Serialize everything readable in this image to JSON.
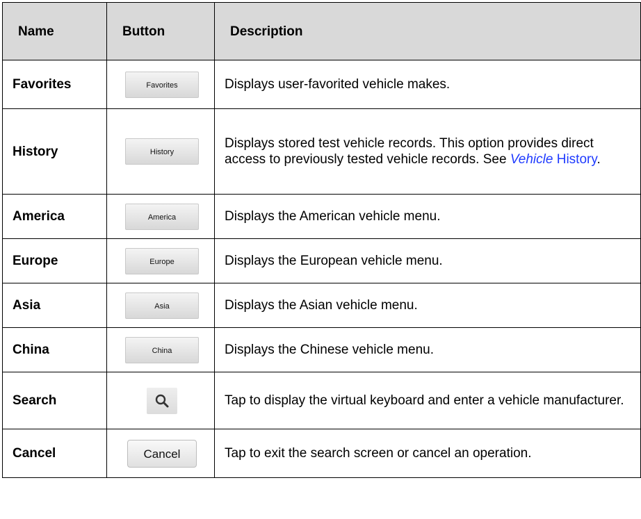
{
  "headers": {
    "name": "Name",
    "button": "Button",
    "description": "Description"
  },
  "rows": [
    {
      "name": "Favorites",
      "button": "Favorites",
      "description": "Displays user-favorited vehicle makes."
    },
    {
      "name": "History",
      "button": "History",
      "description_before": "Displays stored test vehicle records. This option provides direct access to previously tested vehicle records. See ",
      "link_word_1": "Vehicle",
      "link_word_2": "History",
      "description_after": "."
    },
    {
      "name": "America",
      "button": "America",
      "description": "Displays the American vehicle menu."
    },
    {
      "name": "Europe",
      "button": "Europe",
      "description": "Displays the European vehicle menu."
    },
    {
      "name": "Asia",
      "button": "Asia",
      "description": "Displays the Asian vehicle menu."
    },
    {
      "name": "China",
      "button": "China",
      "description": "Displays the Chinese vehicle menu."
    },
    {
      "name": "Search",
      "button_icon": "search-icon",
      "description": "Tap to display the virtual keyboard and enter a vehicle manufacturer."
    },
    {
      "name": "Cancel",
      "button": "Cancel",
      "description": "Tap to exit the search screen or cancel an operation."
    }
  ],
  "colors": {
    "header_bg": "#d9d9d9",
    "link": "#1f3bff",
    "button_bg": "#e6e6e6"
  }
}
